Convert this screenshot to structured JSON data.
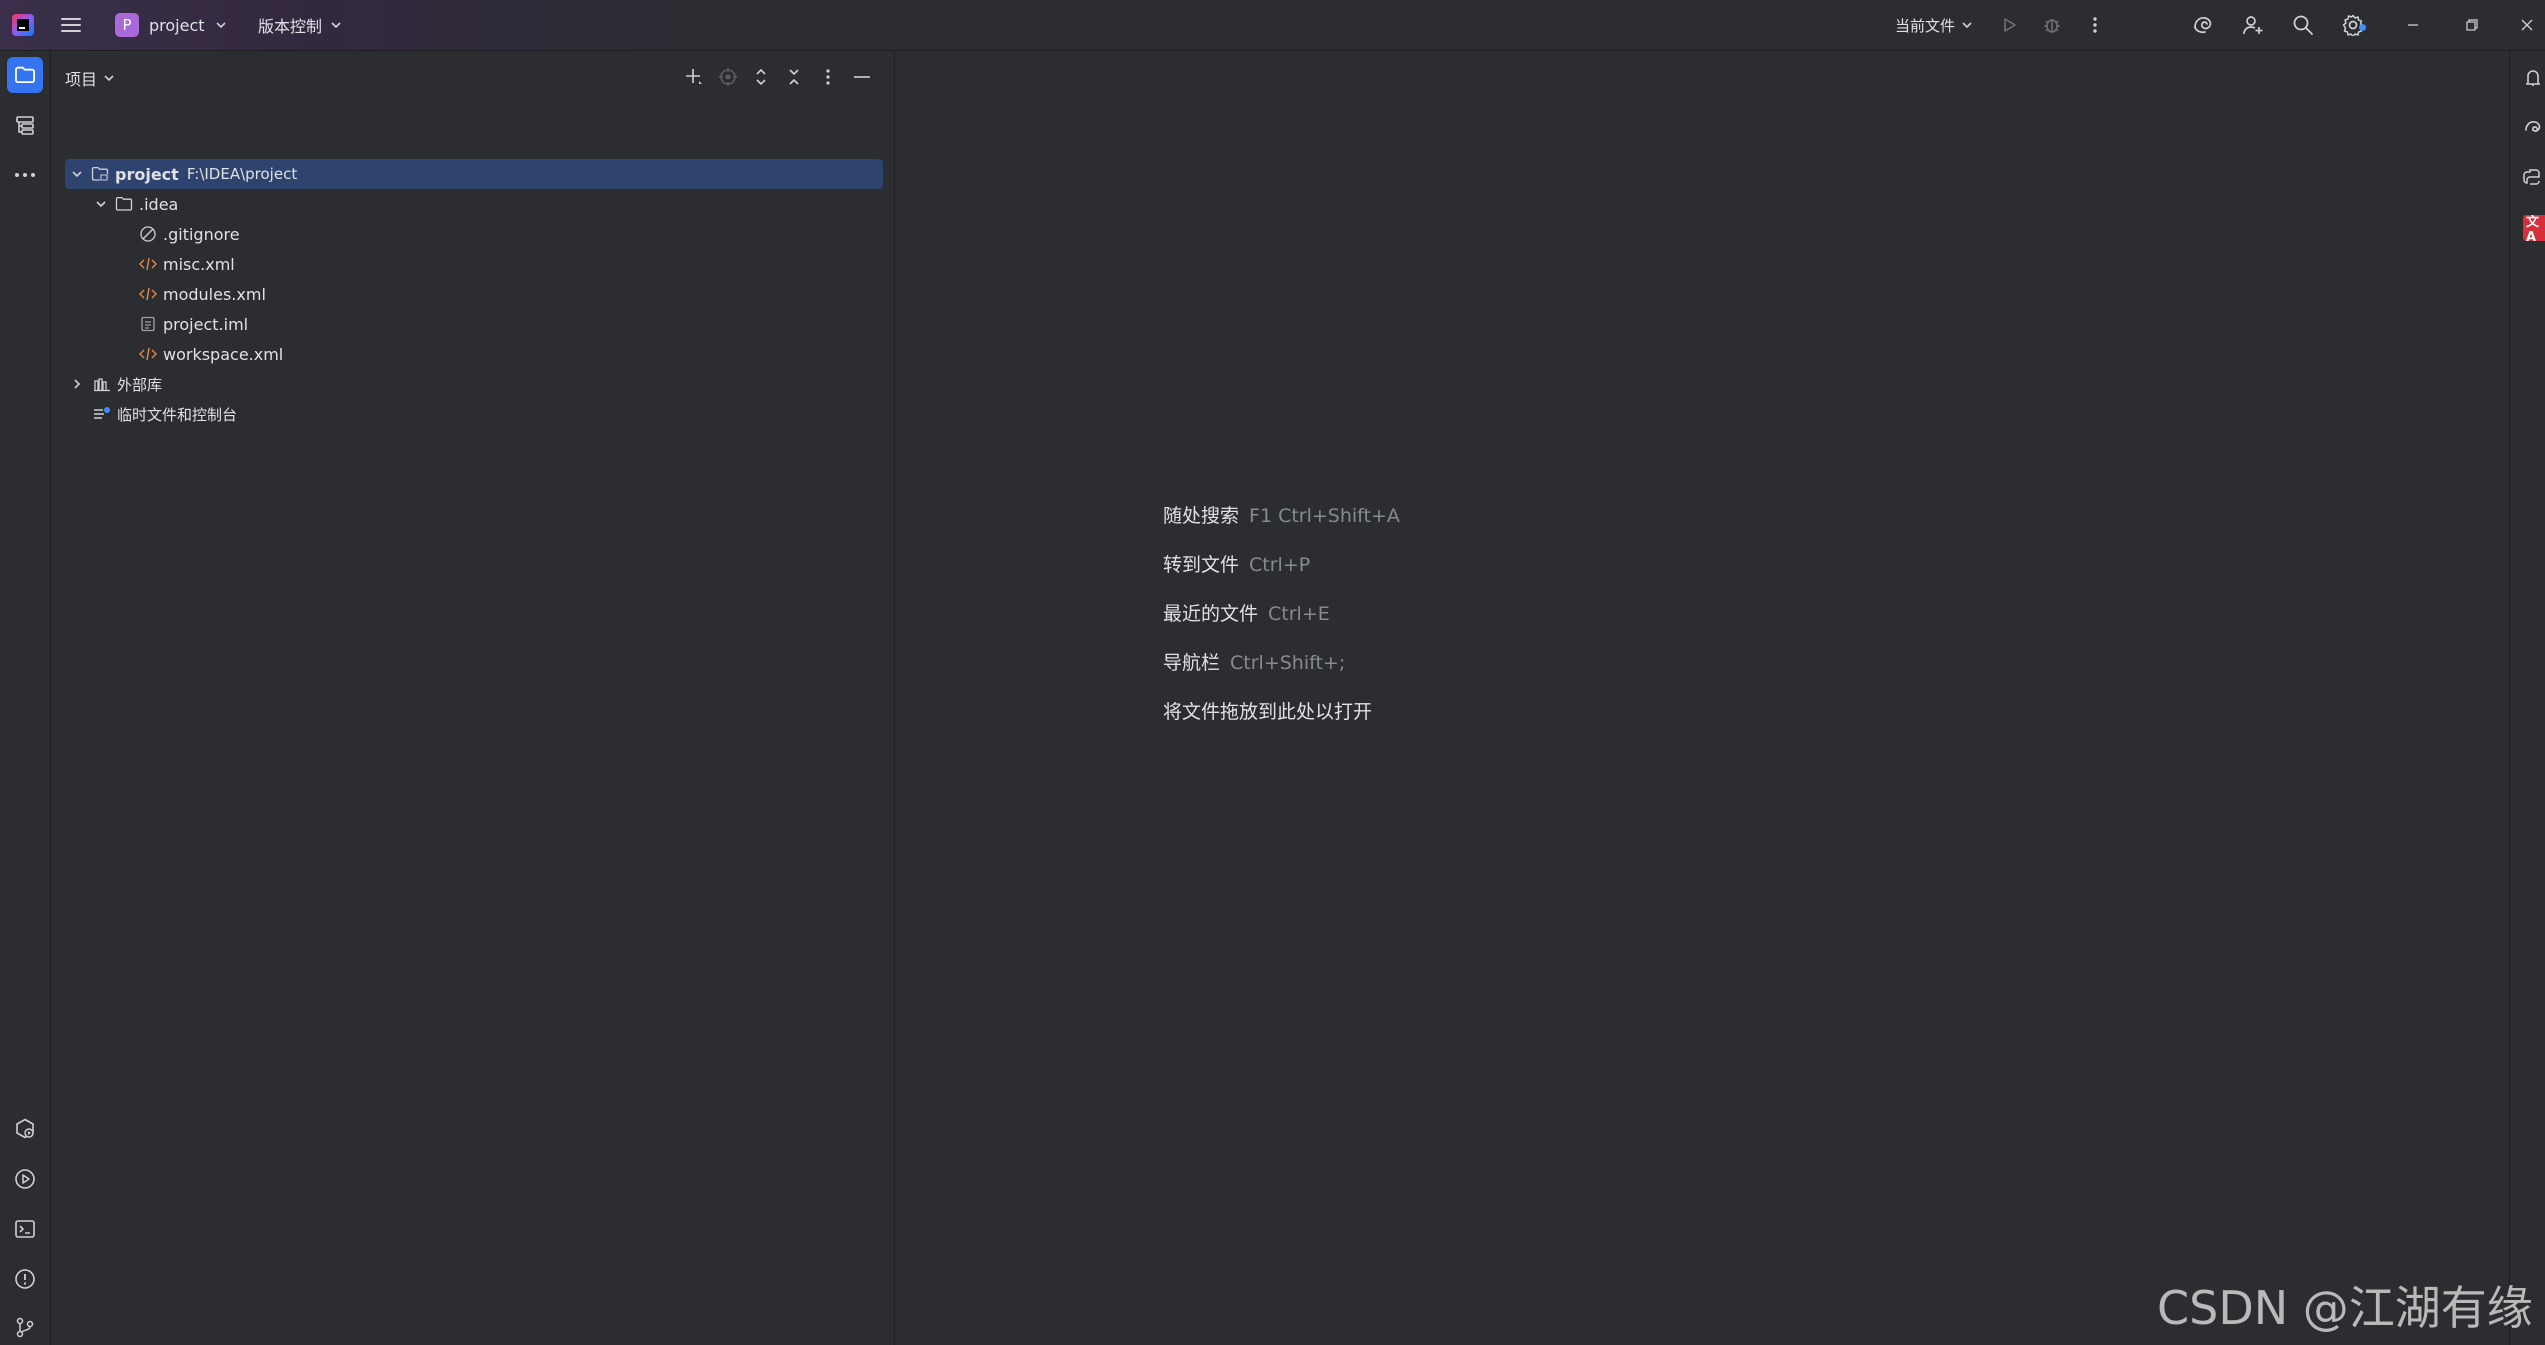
{
  "titlebar": {
    "project_initial": "P",
    "project_name": "project",
    "vcs_label": "版本控制",
    "run_config": "当前文件"
  },
  "project_panel": {
    "title": "项目",
    "tree": [
      {
        "label": "project",
        "path": "F:\\IDEA\\project",
        "type": "project-folder"
      },
      {
        "label": ".idea",
        "type": "folder"
      },
      {
        "label": ".gitignore",
        "type": "ignore-file"
      },
      {
        "label": "misc.xml",
        "type": "xml-file"
      },
      {
        "label": "modules.xml",
        "type": "xml-file"
      },
      {
        "label": "project.iml",
        "type": "iml-file"
      },
      {
        "label": "workspace.xml",
        "type": "xml-file"
      },
      {
        "label": "外部库",
        "type": "library"
      },
      {
        "label": "临时文件和控制台",
        "type": "scratches"
      }
    ]
  },
  "editor": {
    "hints": [
      {
        "label": "随处搜索",
        "shortcut": "F1 Ctrl+Shift+A"
      },
      {
        "label": "转到文件",
        "shortcut": "Ctrl+P"
      },
      {
        "label": "最近的文件",
        "shortcut": "Ctrl+E"
      },
      {
        "label": "导航栏",
        "shortcut": "Ctrl+Shift+;"
      },
      {
        "label": "将文件拖放到此处以打开",
        "shortcut": ""
      }
    ]
  },
  "right_strip": {
    "badge_text": "\t\t"
  },
  "watermark": "CSDN @江湖有缘",
  "colors": {
    "background": "#2b2d30",
    "accent": "#3574f0",
    "selection": "#2e436e",
    "project_badge": "#a76ad8",
    "xml_icon": "#e0894d",
    "notification_badge": "#d6303b"
  },
  "icons": {
    "titlebar": [
      "app-logo",
      "hamburger-menu-icon",
      "run-icon",
      "debug-icon",
      "more-vertical-icon",
      "ai-assistant-icon",
      "add-user-icon",
      "search-icon",
      "settings-icon",
      "minimize-icon",
      "restore-icon",
      "close-icon"
    ],
    "left_strip": [
      "folder-icon",
      "structure-icon",
      "more-horizontal-icon",
      "services-icon",
      "run-panel-icon",
      "terminal-icon",
      "problems-icon",
      "git-icon"
    ],
    "right_strip": [
      "notifications-icon",
      "ai-chat-icon",
      "python-console-icon"
    ]
  }
}
